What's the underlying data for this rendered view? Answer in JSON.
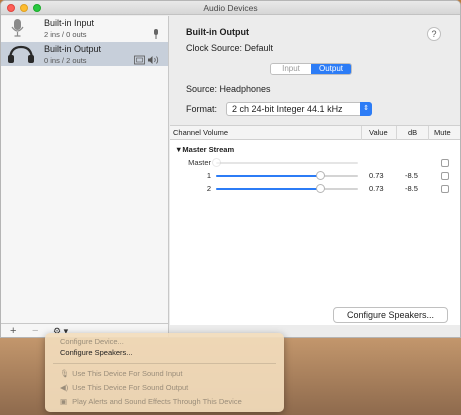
{
  "window": {
    "title": "Audio Devices"
  },
  "sidebar": {
    "devices": [
      {
        "name": "Built-in Input",
        "io": "2 ins / 0 outs",
        "icon": "microphone-icon"
      },
      {
        "name": "Built-in Output",
        "io": "0 ins / 2 outs",
        "icon": "headphones-icon"
      }
    ],
    "add": "+",
    "remove": "−",
    "gear": "⚙ ▾"
  },
  "main": {
    "device_title": "Built-in Output",
    "clock_source": "Clock Source:  Default",
    "help": "?",
    "tabs": [
      "Input",
      "Output"
    ],
    "source": "Source:  Headphones",
    "format_label": "Format:",
    "format_value": "2 ch 24-bit Integer 44.1 kHz",
    "table": {
      "headers": [
        "Channel Volume",
        "Value",
        "dB",
        "Mute"
      ],
      "group": "▼Master Stream",
      "rows": [
        {
          "label": "Master",
          "value": "",
          "db": "",
          "level": 0.0
        },
        {
          "label": "1",
          "value": "0.73",
          "db": "-8.5",
          "level": 0.73
        },
        {
          "label": "2",
          "value": "0.73",
          "db": "-8.5",
          "level": 0.73
        }
      ]
    },
    "configure_button": "Configure Speakers..."
  },
  "menu": {
    "items": [
      {
        "label": "Configure Device...",
        "enabled": false
      },
      {
        "label": "Configure Speakers...",
        "enabled": true
      },
      {
        "label": "Use This Device For Sound Input",
        "enabled": false,
        "icon": "microphone-icon"
      },
      {
        "label": "Use This Device For Sound Output",
        "enabled": false,
        "icon": "speaker-icon"
      },
      {
        "label": "Play Alerts and Sound Effects Through This Device",
        "enabled": false,
        "icon": "alert-icon"
      }
    ]
  },
  "colors": {
    "accent": "#2c7cf6",
    "selection": "#c7cfda"
  }
}
